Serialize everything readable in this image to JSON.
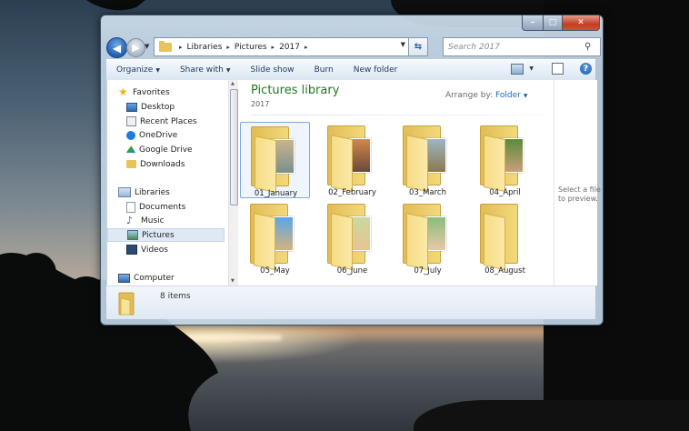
{
  "window": {
    "caption_buttons": {
      "minimize": "–",
      "maximize": "□",
      "close": "✕"
    },
    "address": {
      "crumbs": [
        "Libraries",
        "Pictures",
        "2017"
      ],
      "separator": "▸",
      "refresh": "⇆"
    },
    "search": {
      "placeholder": "Search 2017"
    },
    "nav_buttons": {
      "back": "◀",
      "forward": "▶"
    }
  },
  "toolbar": {
    "organize": "Organize",
    "share_with": "Share with",
    "slide_show": "Slide show",
    "burn": "Burn",
    "new_folder": "New folder",
    "help": "?"
  },
  "sidebar": {
    "favorites": {
      "label": "Favorites",
      "items": [
        "Desktop",
        "Recent Places",
        "OneDrive",
        "Google Drive",
        "Downloads"
      ]
    },
    "libraries": {
      "label": "Libraries",
      "items": [
        "Documents",
        "Music",
        "Pictures",
        "Videos"
      ],
      "selected": "Pictures"
    },
    "computer": {
      "label": "Computer"
    }
  },
  "library": {
    "title": "Pictures library",
    "subtitle": "2017",
    "arrange_label": "Arrange by:",
    "arrange_value": "Folder"
  },
  "folders": [
    {
      "name": "01_January",
      "selected": true
    },
    {
      "name": "02_February"
    },
    {
      "name": "03_March"
    },
    {
      "name": "04_April"
    },
    {
      "name": "05_May"
    },
    {
      "name": "06_June"
    },
    {
      "name": "07_July"
    },
    {
      "name": "08_August"
    }
  ],
  "preview": {
    "text": "Select a file to preview."
  },
  "details": {
    "count": "8 items"
  },
  "colors": {
    "library_title": "#1e7a1e",
    "link": "#1e66b6",
    "selection": "#dfe9f5"
  }
}
